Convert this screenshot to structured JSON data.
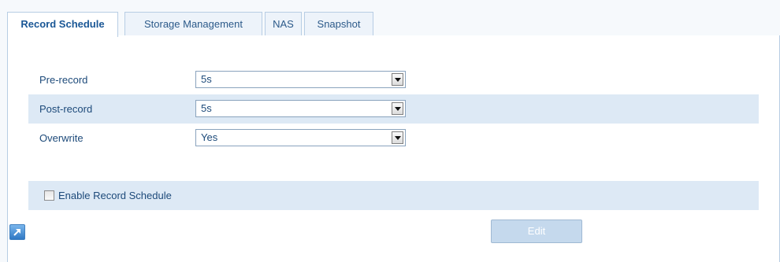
{
  "tabs": [
    {
      "label": "Record Schedule",
      "active": true
    },
    {
      "label": "Storage Management",
      "active": false
    },
    {
      "label": "NAS",
      "active": false
    },
    {
      "label": "Snapshot",
      "active": false
    }
  ],
  "settings": {
    "pre_record": {
      "label": "Pre-record",
      "value": "5s"
    },
    "post_record": {
      "label": "Post-record",
      "value": "5s"
    },
    "overwrite": {
      "label": "Overwrite",
      "value": "Yes"
    }
  },
  "schedule": {
    "enable_label": "Enable Record Schedule",
    "enabled": false
  },
  "actions": {
    "edit_label": "Edit",
    "edit_enabled": false,
    "expand_icon": "expand-arrow-icon"
  },
  "colors": {
    "accent": "#1a5796",
    "row_shade": "#dde9f5",
    "button_disabled": "#c5d9ed"
  }
}
